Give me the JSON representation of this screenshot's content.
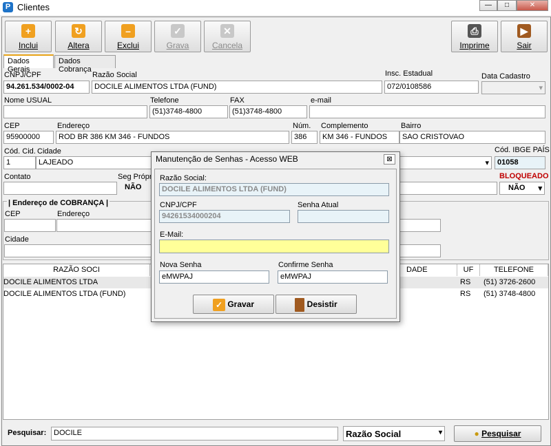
{
  "window": {
    "title": "Clientes",
    "icon_letter": "P"
  },
  "toolbar": {
    "inclui": "Inclui",
    "altera": "Altera",
    "exclui": "Exclui",
    "grava": "Grava",
    "cancela": "Cancela",
    "imprime": "Imprime",
    "sair": "Sair"
  },
  "tabs": [
    "Dados Gerais",
    "Dados Cobrança"
  ],
  "form": {
    "cnpj_label": "CNPJ/CPF",
    "cnpj": "94.261.534/0002-04",
    "razao_label": "Razão Social",
    "razao": "DOCILE ALIMENTOS LTDA (FUND)",
    "insc_label": "Insc. Estadual",
    "insc": "072/0108586",
    "data_cad_label": "Data Cadastro",
    "nome_usual_label": "Nome USUAL",
    "telefone_label": "Telefone",
    "telefone": "(51)3748-4800",
    "fax_label": "FAX",
    "fax": "(51)3748-4800",
    "email_label": "e-mail",
    "cep_label": "CEP",
    "cep": "95900000",
    "endereco_label": "Endereço",
    "endereco": "ROD BR 386 KM 346 - FUNDOS",
    "num_label": "Núm.",
    "num": "386",
    "complemento_label": "Complemento",
    "complemento": "KM 346 - FUNDOS",
    "bairro_label": "Bairro",
    "bairro": "SAO CRISTOVAO",
    "cod_cid_label": "Cód. Cid.",
    "cod_cid": "1",
    "cidade_label": "Cidade",
    "cidade": "LAJEADO",
    "cod_ibge_pais_label": "Cód. IBGE PAÍS",
    "cod_ibge_pais": "01058",
    "contato_label": "Contato",
    "seg_label": "Seg Própr",
    "seg": "NÃO",
    "bloqueado_label": "BLOQUEADO",
    "bloqueado": "NÃO",
    "cobranca_title": "| Endereço de COBRANÇA |",
    "cob_cep_label": "CEP",
    "cob_end_label": "Endereço",
    "cob_cidade_label": "Cidade"
  },
  "grid": {
    "headers": {
      "razao": "RAZÃO SOCI",
      "cidade": "DADE",
      "uf": "UF",
      "telefone": "TELEFONE"
    },
    "rows": [
      {
        "razao": "DOCILE ALIMENTOS LTDA",
        "uf": "RS",
        "telefone": "(51) 3726-2600"
      },
      {
        "razao": "DOCILE ALIMENTOS LTDA (FUND)",
        "uf": "RS",
        "telefone": "(51) 3748-4800"
      }
    ]
  },
  "dialog": {
    "title": "Manutenção de Senhas - Acesso WEB",
    "razao_label": "Razão Social:",
    "razao": "DOCILE ALIMENTOS LTDA (FUND)",
    "cnpj_label": "CNPJ/CPF",
    "cnpj": "94261534000204",
    "senha_atual_label": "Senha Atual",
    "senha_atual": "",
    "email_label": "E-Mail:",
    "email": "",
    "nova_label": "Nova Senha",
    "nova": "eMWPAJ",
    "confirme_label": "Confirme Senha",
    "confirme": "eMWPAJ",
    "gravar": "Gravar",
    "desistir": "Desistir"
  },
  "search": {
    "label": "Pesquisar:",
    "value": "DOCILE",
    "field_option": "Razão Social",
    "button": "Pesquisar"
  },
  "colors": {
    "email_field_bg": "#ffff99",
    "readonly_field_bg": "#e8f3f8",
    "accent": "#e8a317",
    "alert": "#c00000"
  }
}
